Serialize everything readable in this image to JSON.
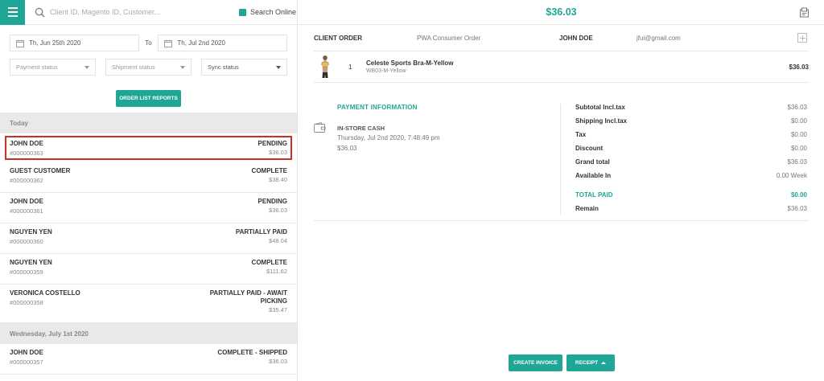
{
  "search": {
    "placeholder": "Client ID, Magento ID, Customer..."
  },
  "search_online": {
    "label": "Search Online",
    "checked": true
  },
  "filters": {
    "date_from": "Th, Jun 25th 2020",
    "to_label": "To",
    "date_to": "Th, Jul 2nd 2020",
    "payment_status": "Payment status",
    "shipment_status": "Shipment status",
    "sync_status": "Sync status"
  },
  "report_button": "ORDER LIST REPORTS",
  "groups": [
    {
      "label": "Today",
      "orders": [
        {
          "name": "JOHN DOE",
          "id": "#000000363",
          "status": "PENDING",
          "total": "$36.03"
        },
        {
          "name": "GUEST CUSTOMER",
          "id": "#000000362",
          "status": "COMPLETE",
          "total": "$38.40"
        },
        {
          "name": "JOHN DOE",
          "id": "#000000361",
          "status": "PENDING",
          "total": "$36.03"
        },
        {
          "name": "NGUYEN YEN",
          "id": "#000000360",
          "status": "PARTIALLY PAID",
          "total": "$48.04"
        },
        {
          "name": "NGUYEN YEN",
          "id": "#000000359",
          "status": "COMPLETE",
          "total": "$111.62"
        },
        {
          "name": "VERONICA COSTELLO",
          "id": "#000000358",
          "status": "PARTIALLY PAID - AWAIT PICKING",
          "total": "$35.47"
        }
      ]
    },
    {
      "label": "Wednesday, July 1st 2020",
      "orders": [
        {
          "name": "JOHN DOE",
          "id": "#000000357",
          "status": "COMPLETE - SHIPPED",
          "total": "$36.03"
        }
      ]
    }
  ],
  "detail": {
    "grand_total": "$36.03",
    "client_label": "CLIENT ORDER",
    "order_type": "PWA Consumer Order",
    "customer_name": "JOHN DOE",
    "customer_email": "jfui@gmail.com",
    "item": {
      "qty": "1",
      "name": "Celeste Sports Bra-M-Yellow",
      "sku": "WB03-M-Yellow",
      "price": "$36.03"
    },
    "payment": {
      "title": "PAYMENT INFORMATION",
      "method": "IN-STORE CASH",
      "date": "Thursday, Jul 2nd 2020, 7:48:49 pm",
      "amount": "$36.03"
    },
    "totals": [
      {
        "label": "Subtotal Incl.tax",
        "value": "$36.03"
      },
      {
        "label": "Shipping Incl.tax",
        "value": "$0.00"
      },
      {
        "label": "Tax",
        "value": "$0.00"
      },
      {
        "label": "Discount",
        "value": "$0.00"
      },
      {
        "label": "Grand total",
        "value": "$36.03"
      },
      {
        "label": "Available In",
        "value": "0.00 Week"
      }
    ],
    "total_paid": {
      "label": "TOTAL PAID",
      "value": "$0.00"
    },
    "remain": {
      "label": "Remain",
      "value": "$36.03"
    },
    "create_invoice": "CREATE INVOICE",
    "receipt": "RECEIPT"
  },
  "colors": {
    "accent": "#20a696",
    "selected_border": "#c9302c"
  }
}
